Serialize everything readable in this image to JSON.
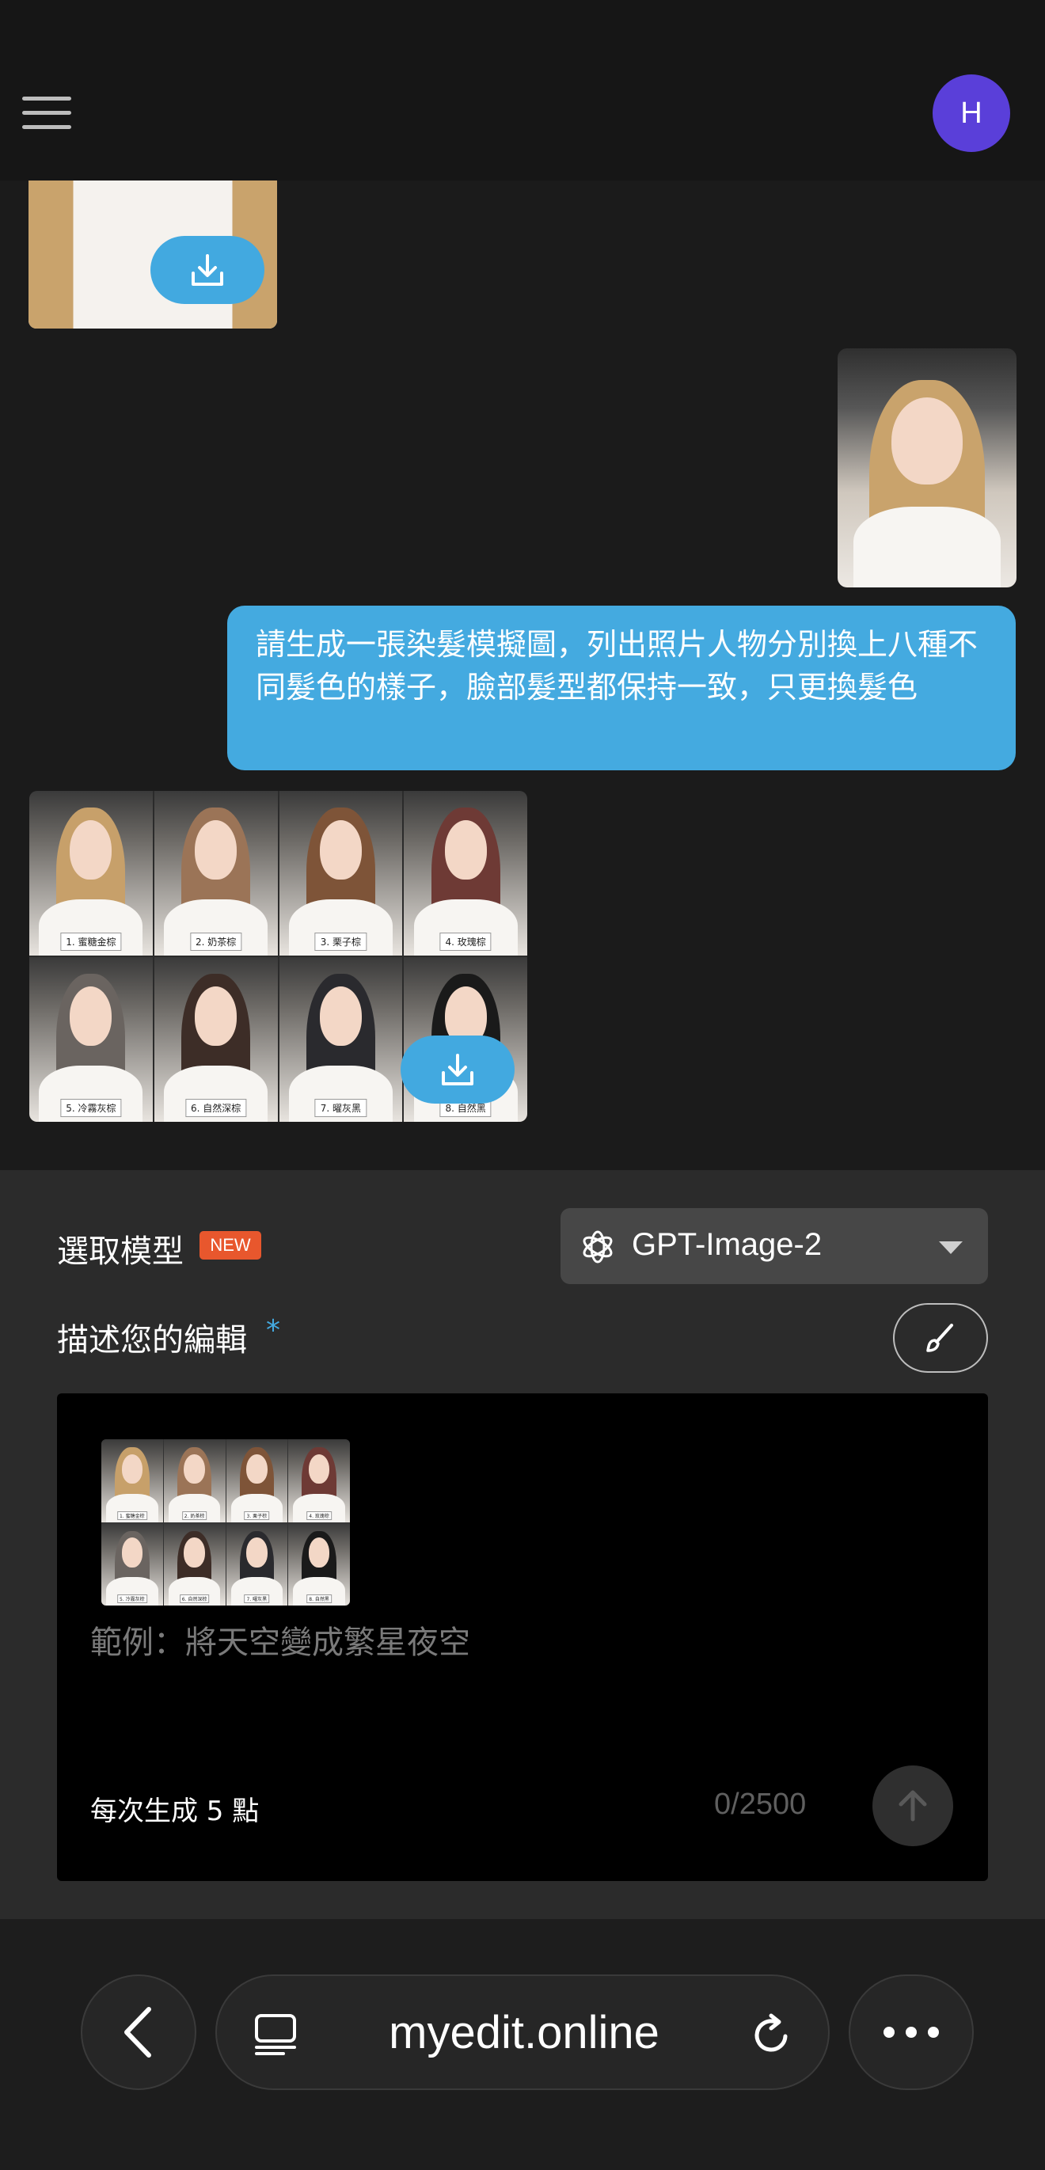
{
  "header": {
    "avatar_initial": "H"
  },
  "chat": {
    "user_message": "請生成一張染髮模擬圖，列出照片人物分別換上八種不同髮色的樣子，臉部髮型都保持一致，只更換髮色",
    "result_labels": [
      "1. 蜜糖金棕",
      "2. 奶茶棕",
      "3. 栗子棕",
      "4. 玫瑰棕",
      "5. 冷霧灰棕",
      "6. 自然深棕",
      "7. 曜灰黑",
      "8. 自然黑"
    ],
    "hair_colors": [
      "#c7a06a",
      "#9b7457",
      "#7e5438",
      "#6e3a35",
      "#6a6460",
      "#3d2d27",
      "#2a2a2e",
      "#1a1a1a"
    ]
  },
  "panel": {
    "model_label": "選取模型",
    "new_badge": "NEW",
    "model_name": "GPT-Image-2",
    "describe_label": "描述您的編輯",
    "required_mark": "*",
    "placeholder": "範例：將天空變成繁星夜空",
    "points_text": "每次生成 5 點",
    "char_counter": "0/2500"
  },
  "browser": {
    "url": "myedit.online"
  },
  "colors": {
    "accent": "#44aae0",
    "avatar": "#5a3fd9",
    "badge": "#e8572d"
  }
}
